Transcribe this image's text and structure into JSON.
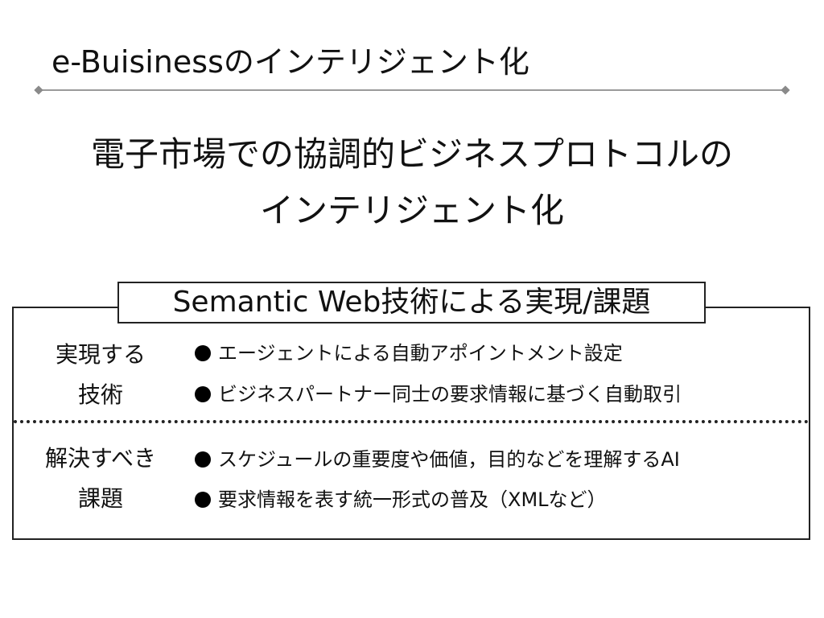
{
  "slide": {
    "title": "e-Buisinessのインテリジェント化",
    "headline": {
      "line1": "電子市場での協調的ビジネスプロトコルの",
      "line2": "インテリジェント化"
    },
    "box": {
      "title": "Semantic Web技術による実現/課題",
      "sections": [
        {
          "label_line1": "実現する",
          "label_line2": "技術",
          "bullets": [
            "エージェントによる自動アポイントメント設定",
            "ビジネスパートナー同士の要求情報に基づく自動取引"
          ]
        },
        {
          "label_line1": "解決すべき",
          "label_line2": "課題",
          "bullets": [
            "スケジュールの重要度や価値，目的などを理解するAI",
            "要求情報を表す統一形式の普及（XMLなど）"
          ]
        }
      ]
    }
  }
}
